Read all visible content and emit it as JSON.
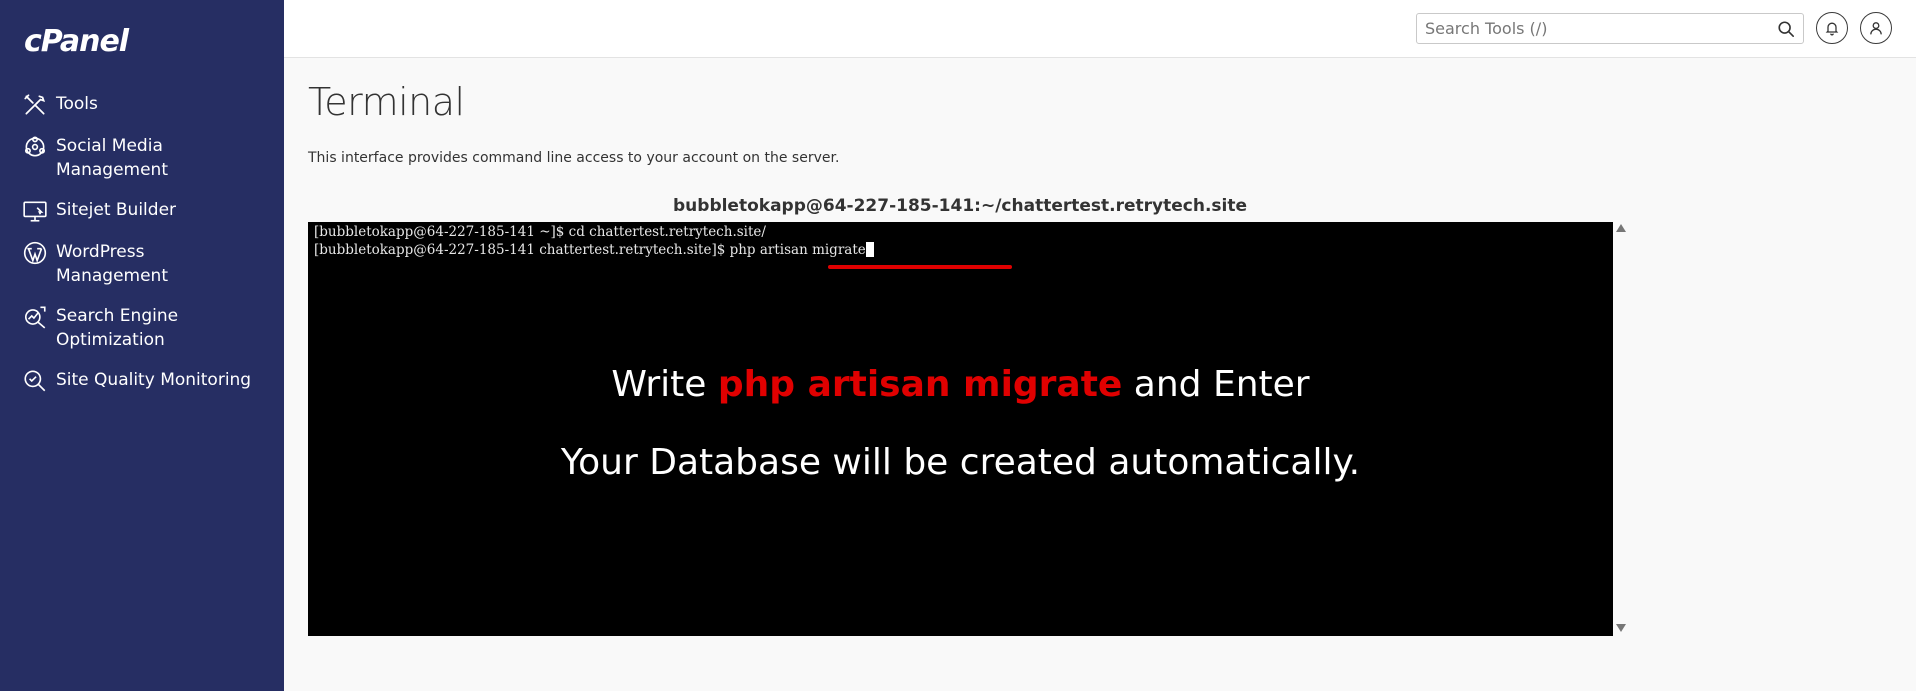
{
  "brand": {
    "logo": "cPanel"
  },
  "sidebar": {
    "items": [
      {
        "label": "Tools",
        "icon": "tools-icon"
      },
      {
        "label": "Social Media Management",
        "icon": "social-media-icon"
      },
      {
        "label": "Sitejet Builder",
        "icon": "sitejet-icon"
      },
      {
        "label": "WordPress Management",
        "icon": "wordpress-icon"
      },
      {
        "label": "Search Engine Optimization",
        "icon": "seo-icon"
      },
      {
        "label": "Site Quality Monitoring",
        "icon": "site-quality-icon"
      }
    ]
  },
  "header": {
    "search": {
      "placeholder": "Search Tools (/)",
      "value": ""
    }
  },
  "main": {
    "title": "Terminal",
    "description": "This interface provides command line access to your account on the server.",
    "terminal_title": "bubbletokapp@64-227-185-141:~/chattertest.retrytech.site",
    "lines": [
      "[bubbletokapp@64-227-185-141 ~]$ cd chattertest.retrytech.site/",
      "[bubbletokapp@64-227-185-141 chattertest.retrytech.site]$ php artisan migrate"
    ],
    "overlay": {
      "prefix": "Write ",
      "highlight": "php artisan migrate",
      "suffix": " and Enter",
      "line2": "Your Database will be created automatically."
    }
  },
  "colors": {
    "sidebar_bg": "#262e63",
    "highlight_red": "#e00000",
    "terminal_bg": "#000000"
  }
}
